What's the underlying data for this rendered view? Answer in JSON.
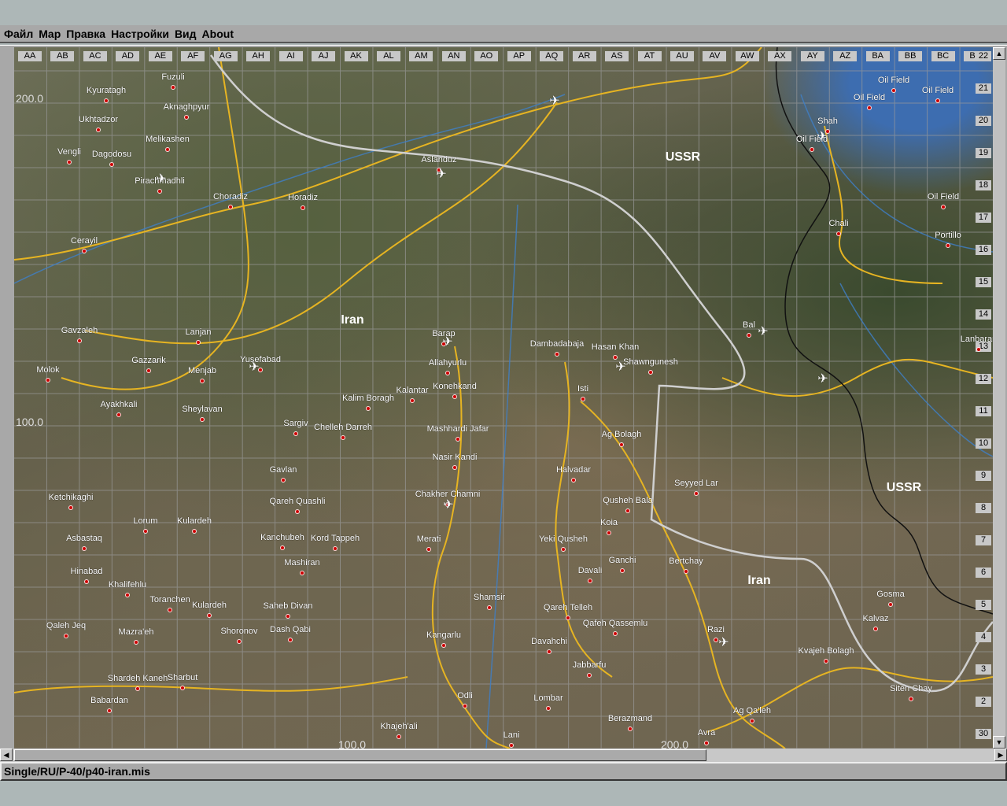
{
  "menu": [
    "Файл",
    "Map",
    "Правка",
    "Настройки",
    "Вид",
    "About"
  ],
  "columns": [
    "AA",
    "AB",
    "AC",
    "AD",
    "AE",
    "AF",
    "AG",
    "AH",
    "AI",
    "AJ",
    "AK",
    "AL",
    "AM",
    "AN",
    "AO",
    "AP",
    "AQ",
    "AR",
    "AS",
    "AT",
    "AU",
    "AV",
    "AW",
    "AX",
    "AY",
    "AZ",
    "BA",
    "BB",
    "BC",
    "BD"
  ],
  "rows": [
    "22",
    "21",
    "20",
    "19",
    "18",
    "17",
    "16",
    "15",
    "14",
    "13",
    "12",
    "11",
    "10",
    "9",
    "8",
    "7",
    "6",
    "5",
    "4",
    "3",
    "2",
    "30"
  ],
  "scale_labels": [
    "200.0",
    "100.0",
    "100.0",
    "200.0"
  ],
  "regions": [
    "USSR",
    "USSR",
    "Iran",
    "Iran"
  ],
  "towns": [
    "Fuzuli",
    "Kyuratagh",
    "Aknaghpyur",
    "Ukhtadzor",
    "Melikashen",
    "Vengli",
    "Dagodosu",
    "Pirachmadhli",
    "Choradiz",
    "Horadiz",
    "Aslanduz",
    "Cerayil",
    "Gavzaleh",
    "Lanjan",
    "Yusefabad",
    "Gazzarik",
    "Molok",
    "Menjab",
    "Ayakhkali",
    "Sheylavan",
    "Barap",
    "Allahyurlu",
    "Dambadabaja",
    "Hasan Khan",
    "Shawngunesh",
    "Konehkand",
    "Kalantar",
    "Kalim Boragh",
    "Isti",
    "Sargiv",
    "Chelleh Darreh",
    "Mashhardi Jafar",
    "Ag Bolagh",
    "Nasir Kandi",
    "Halvadar",
    "Gavlan",
    "Seyyed Lar",
    "Ketchikaghi",
    "Qareh Quashli",
    "Chakher Chamni",
    "Qusheh Bala",
    "Lorum",
    "Kulardeh",
    "Koia",
    "Asbastaq",
    "Kanchubeh",
    "Kord Tappeh",
    "Merati",
    "Yeki Qusheh",
    "Bertchay",
    "Ganchi",
    "Hinabad",
    "Mashiran",
    "Davali",
    "Khalifehlu",
    "Toranchen",
    "Kulardeh",
    "Saheb Divan",
    "Shamsir",
    "Qareh Telleh",
    "Gosma",
    "Kalvaz",
    "Qaleh Jeq",
    "Mazra'eh",
    "Shoronov",
    "Dash Qabi",
    "Qafeh Qassemlu",
    "Razi",
    "Kangarlu",
    "Davahchi",
    "Kvajeh Bolagh",
    "Jabbarfu",
    "Shardeh Kaneh",
    "Sharbut",
    "Siteh Chay",
    "Odli",
    "Babardan",
    "Lombar",
    "Ag Qa'leh",
    "Berazmand",
    "Khajeh'ali",
    "Lani",
    "Avra",
    "Chali",
    "Portillo",
    "Oil Field",
    "Oil Field",
    "Oil Field",
    "Oil Field",
    "Shah",
    "Oil Field",
    "Bal",
    "Lanbaran"
  ],
  "status": {
    "mission_path": "Single/RU/P-40/p40-iran.mis"
  },
  "colors": {
    "road": "#e6b422",
    "river": "#3f7fc8",
    "border": "#111111",
    "front": "#cfcfcf",
    "town_dot": "#cc0000"
  }
}
